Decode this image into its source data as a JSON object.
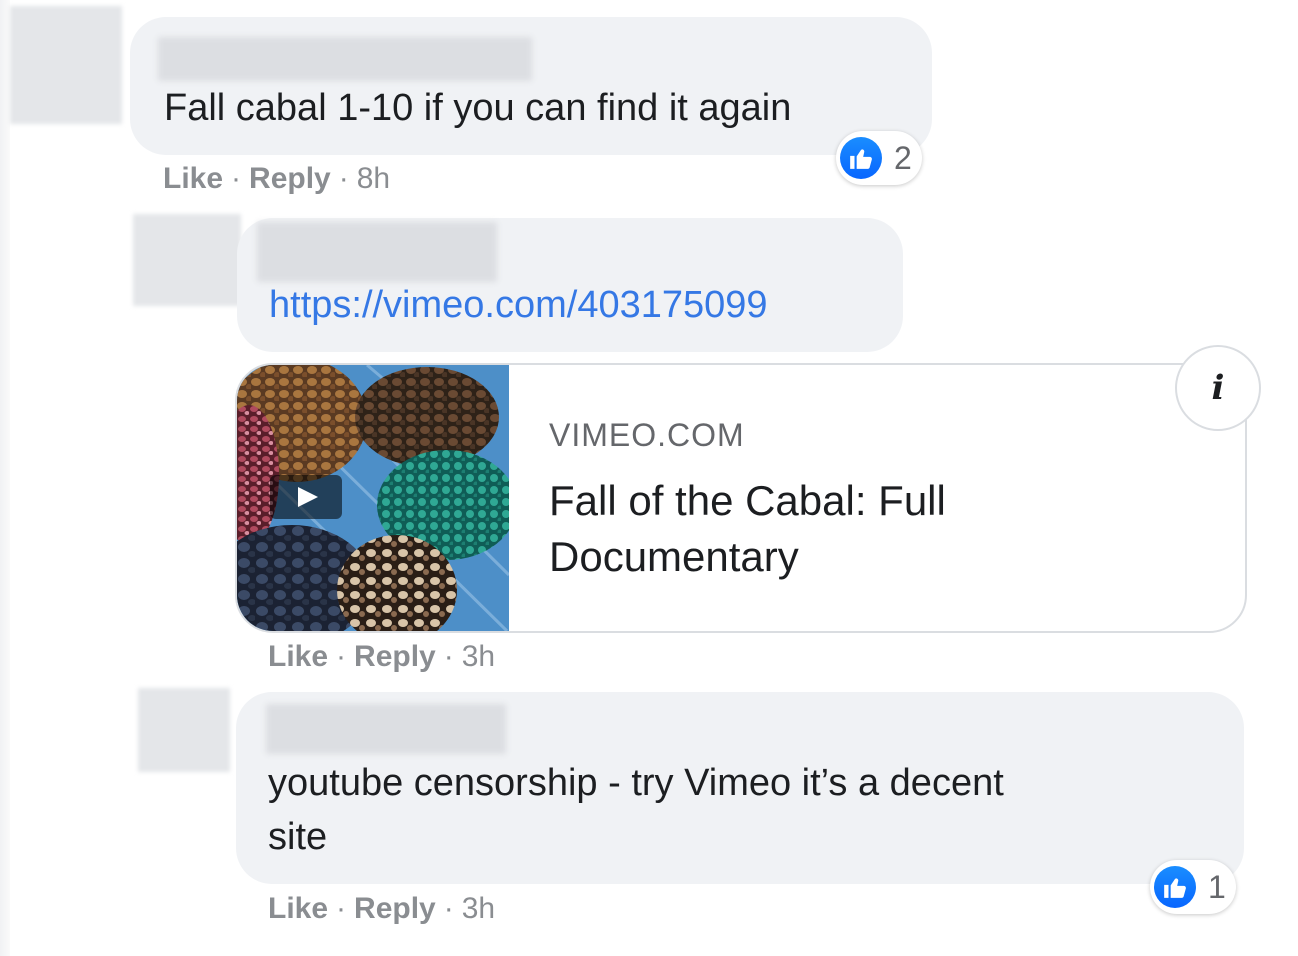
{
  "comments": [
    {
      "text": "Fall cabal 1-10 if you can find it again",
      "actions": {
        "like": "Like",
        "reply": "Reply",
        "time": "8h"
      },
      "reactions": {
        "icon": "thumbs-up-icon",
        "count": "2"
      }
    },
    {
      "link_text": "https://vimeo.com/403175099",
      "preview": {
        "domain": "VIMEO.COM",
        "title": "Fall of the Cabal: Full Documentary",
        "info_icon": "info-icon"
      },
      "actions": {
        "like": "Like",
        "reply": "Reply",
        "time": "3h"
      }
    },
    {
      "text_line1": "youtube censorship - try Vimeo it’s a decent",
      "text_line2": "site",
      "actions": {
        "like": "Like",
        "reply": "Reply",
        "time": "3h"
      },
      "reactions": {
        "icon": "thumbs-up-icon",
        "count": "1"
      }
    }
  ],
  "separator": "·",
  "colors": {
    "like_blue": "#0866ff",
    "link": "#3578e5",
    "bubble": "#f0f2f5",
    "meta": "#8a8d91"
  }
}
